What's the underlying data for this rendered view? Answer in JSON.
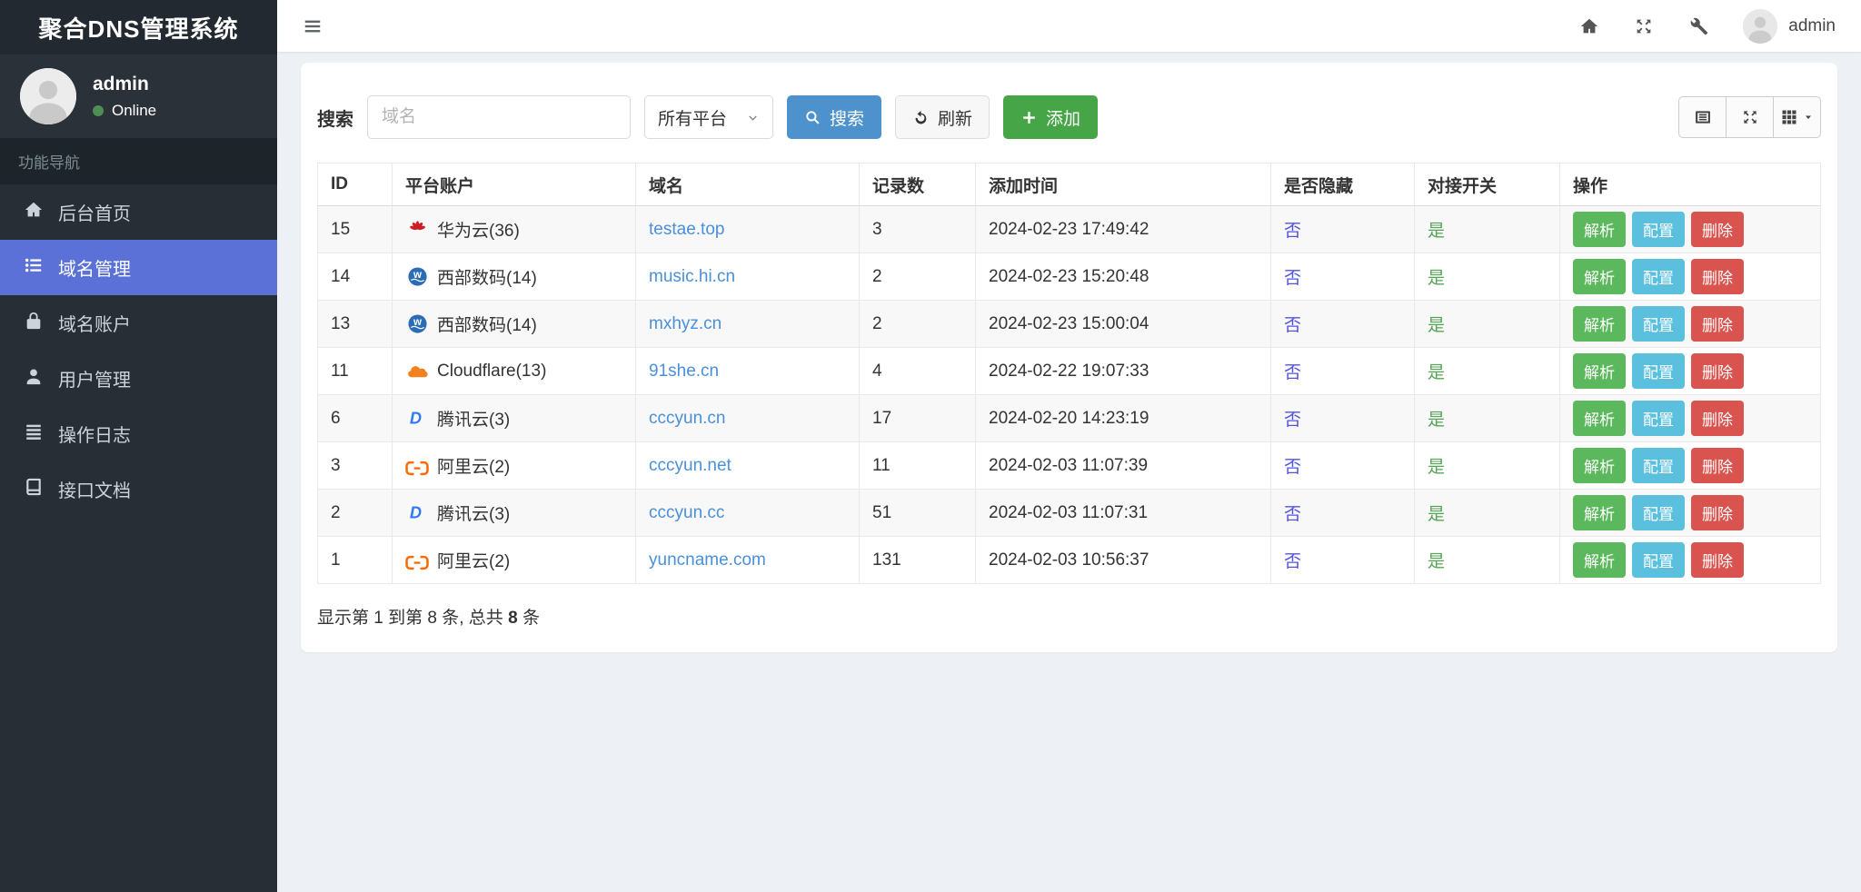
{
  "app": {
    "title": "聚合DNS管理系统"
  },
  "sidebar": {
    "user": {
      "name": "admin",
      "status": "Online"
    },
    "section_label": "功能导航",
    "items": [
      {
        "label": "后台首页",
        "icon": "home-icon",
        "active": false
      },
      {
        "label": "域名管理",
        "icon": "list-icon",
        "active": true
      },
      {
        "label": "域名账户",
        "icon": "lock-icon",
        "active": false
      },
      {
        "label": "用户管理",
        "icon": "user-icon",
        "active": false
      },
      {
        "label": "操作日志",
        "icon": "log-icon",
        "active": false
      },
      {
        "label": "接口文档",
        "icon": "book-icon",
        "active": false
      }
    ]
  },
  "topbar": {
    "username": "admin"
  },
  "search": {
    "label": "搜索",
    "placeholder": "域名",
    "platform_select": "所有平台",
    "search_button": "搜索",
    "refresh_button": "刷新",
    "add_button": "添加"
  },
  "table": {
    "headers": [
      "ID",
      "平台账户",
      "域名",
      "记录数",
      "添加时间",
      "是否隐藏",
      "对接开关",
      "操作"
    ],
    "actions": [
      "解析",
      "配置",
      "删除"
    ],
    "rows": [
      {
        "id": "15",
        "platform": "华为云(36)",
        "platform_icon": "huawei-icon",
        "domain": "testae.top",
        "records": "3",
        "added": "2024-02-23 17:49:42",
        "hidden": "否",
        "switch": "是"
      },
      {
        "id": "14",
        "platform": "西部数码(14)",
        "platform_icon": "west-icon",
        "domain": "music.hi.cn",
        "records": "2",
        "added": "2024-02-23 15:20:48",
        "hidden": "否",
        "switch": "是"
      },
      {
        "id": "13",
        "platform": "西部数码(14)",
        "platform_icon": "west-icon",
        "domain": "mxhyz.cn",
        "records": "2",
        "added": "2024-02-23 15:00:04",
        "hidden": "否",
        "switch": "是"
      },
      {
        "id": "11",
        "platform": "Cloudflare(13)",
        "platform_icon": "cloudflare-icon",
        "domain": "91she.cn",
        "records": "4",
        "added": "2024-02-22 19:07:33",
        "hidden": "否",
        "switch": "是"
      },
      {
        "id": "6",
        "platform": "腾讯云(3)",
        "platform_icon": "dnspod-icon",
        "domain": "cccyun.cn",
        "records": "17",
        "added": "2024-02-20 14:23:19",
        "hidden": "否",
        "switch": "是"
      },
      {
        "id": "3",
        "platform": "阿里云(2)",
        "platform_icon": "aliyun-icon",
        "domain": "cccyun.net",
        "records": "11",
        "added": "2024-02-03 11:07:39",
        "hidden": "否",
        "switch": "是"
      },
      {
        "id": "2",
        "platform": "腾讯云(3)",
        "platform_icon": "dnspod-icon",
        "domain": "cccyun.cc",
        "records": "51",
        "added": "2024-02-03 11:07:31",
        "hidden": "否",
        "switch": "是"
      },
      {
        "id": "1",
        "platform": "阿里云(2)",
        "platform_icon": "aliyun-icon",
        "domain": "yuncname.com",
        "records": "131",
        "added": "2024-02-03 10:56:37",
        "hidden": "否",
        "switch": "是"
      }
    ],
    "footer": {
      "prefix": "显示第 1 到第 8 条, 总共 ",
      "total": "8",
      "suffix": " 条"
    }
  },
  "colors": {
    "accent": "#5b71d8",
    "online_dot": "#4f8f54",
    "primary_button": "#4d92cc",
    "success_button": "#46a546",
    "resolve_button": "#5cb85c",
    "config_button": "#5bc0de",
    "delete_button": "#d9534f",
    "domain_link": "#4a90d9",
    "hidden_link": "#5352e0",
    "switch_link": "#56a456"
  }
}
